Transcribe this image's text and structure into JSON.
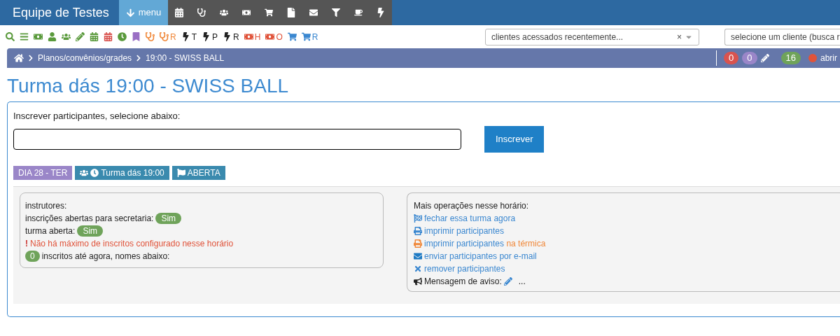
{
  "header": {
    "title": "Equipe de Testes",
    "menu_button": "menu"
  },
  "quick_icons": [
    {
      "color": "#5a9a3c"
    },
    {
      "color": "#5a9a3c"
    },
    {
      "color": "#5a9a3c"
    },
    {
      "color": "#5a9a3c"
    },
    {
      "color": "#5a9a3c"
    },
    {
      "color": "#5a9a3c"
    },
    {
      "color": "#5a9a3c"
    },
    {
      "color": "#d9534f"
    },
    {
      "color": "#5a9a3c"
    },
    {
      "color": "#9a6fc4"
    },
    {
      "color": "#f0883a"
    },
    {
      "color": "#f0883a",
      "label": "R"
    },
    {
      "color": "#222222",
      "label": "T"
    },
    {
      "color": "#222222",
      "label": "P"
    },
    {
      "color": "#222222",
      "label": "R"
    },
    {
      "color": "#e0533a",
      "label": "H"
    },
    {
      "color": "#e0533a",
      "label": "O"
    },
    {
      "color": "#3a87d0"
    },
    {
      "color": "#3a87d0",
      "label": "R"
    }
  ],
  "recent_clients": {
    "placeholder": "clientes acessados recentemente...",
    "clear": "×"
  },
  "client_search": {
    "placeholder": "selecione um cliente (busca r"
  },
  "breadcrumb": [
    "Planos/convênios/grades",
    "19:00 - SWISS BALL"
  ],
  "counters": [
    {
      "text": "0",
      "color": "#d9534f"
    },
    {
      "text": "0",
      "color": "#9a86c8"
    },
    {
      "text": "16",
      "color": "#6fa35a"
    }
  ],
  "status_dot": {
    "color": "#e0533a",
    "label": "abrir"
  },
  "page_title": "Turma dás 19:00 - SWISS BALL",
  "enroll": {
    "label": "Inscrever participantes, selecione abaixo:",
    "button": "Inscrever"
  },
  "tags": [
    {
      "text": "DIA 28 - TER",
      "color": "#9a86c8"
    },
    {
      "text": "Turma dás 19:00",
      "color": "#3a8aae"
    },
    {
      "text": "ABERTA",
      "color": "#3a8aae"
    }
  ],
  "info": {
    "instructors": "instrutores:",
    "lines": [
      {
        "text": "inscrições abertas para secretaria:",
        "badge": "Sim"
      },
      {
        "text": "turma aberta:",
        "badge": "Sim"
      }
    ],
    "warning_mark": "!",
    "warning": "Não há máximo de inscritos configurado nesse horário",
    "count": "0",
    "count_text": "inscritos até agora, nomes abaixo:"
  },
  "operations": {
    "title": "Mais operações nesse horário:",
    "links": [
      {
        "text": "fechar essa turma agora"
      },
      {
        "text": "imprimir participantes"
      },
      {
        "text": "imprimir participantes",
        "extra": "na térmica"
      },
      {
        "text": "enviar participantes por e-mail"
      },
      {
        "text": "remover participantes"
      }
    ],
    "message_label": "Mensagem de aviso:",
    "message_value": "..."
  }
}
